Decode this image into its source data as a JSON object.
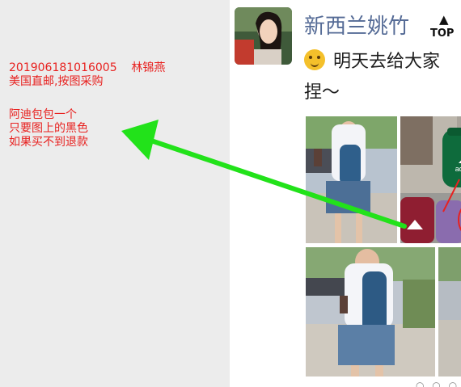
{
  "annotation": {
    "order_line": "201906181016005    林锦燕",
    "order_sub": "美国直邮,按图采购",
    "request": [
      "阿迪包包一个",
      "只要图上的黑色",
      "如果买不到退款"
    ],
    "highlight_color": "#e8211f",
    "arrow_color": "#22e21a"
  },
  "post": {
    "author": "新西兰姚竹",
    "top_badge": "TOP",
    "name_tail": "□",
    "text_line1": "明天去给大家",
    "text_line2": "捏～",
    "emoji": "thinking-face-emoji"
  },
  "photos": {
    "bag_brand": "adidas"
  },
  "footer": {
    "dots": "○ ○ ○"
  }
}
